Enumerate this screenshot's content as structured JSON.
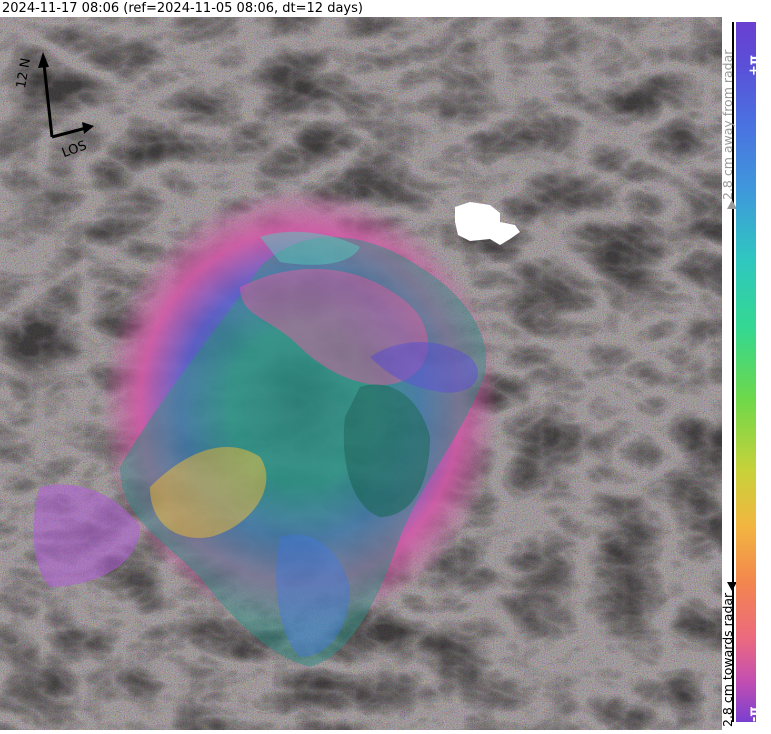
{
  "title": "2024-11-17 08:06 (ref=2024-11-05 08:06, dt=12 days)",
  "compass": {
    "north_label": "12 N",
    "los_label": "LOS"
  },
  "colorbar": {
    "top_label": "+π",
    "bottom_label": "-π",
    "away_label": "2.8 cm away from radar",
    "towards_label": "2.8 cm towards radar"
  }
}
